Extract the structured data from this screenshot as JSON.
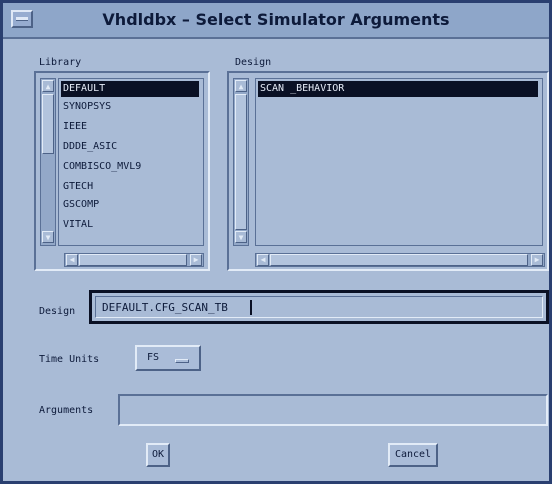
{
  "window": {
    "title": "Vhdldbx – Select Simulator Arguments"
  },
  "library": {
    "label": "Library",
    "items": [
      "DEFAULT",
      "SYNOPSYS",
      "IEEE",
      "DDDE_ASIC",
      "COMBISCO_MVL9",
      "GTECH",
      "GSCOMP",
      "VITAL"
    ],
    "selected_index": 0
  },
  "design_list": {
    "label": "Design",
    "items": [
      "SCAN _BEHAVIOR"
    ],
    "selected_index": 0
  },
  "design_field": {
    "label": "Design",
    "value": "DEFAULT.CFG_SCAN_TB"
  },
  "time_units": {
    "label": "Time Units",
    "selected": "FS"
  },
  "arguments": {
    "label": "Arguments",
    "value": ""
  },
  "buttons": {
    "ok": "OK",
    "cancel": "Cancel"
  },
  "icons": {
    "window_menu": "window-menu-icon",
    "scroll_up": "arrow-up-icon",
    "scroll_down": "arrow-down-icon",
    "scroll_left": "arrow-left-icon",
    "scroll_right": "arrow-right-icon",
    "option_menu": "option-menu-indicator-icon"
  },
  "colors": {
    "title_bar": "#8ea6c9",
    "background": "#a9bbd6",
    "selection": "#0a1024",
    "text": "#0d1a3a"
  }
}
